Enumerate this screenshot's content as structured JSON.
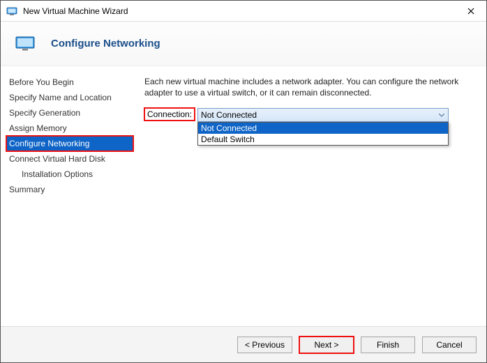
{
  "window": {
    "title": "New Virtual Machine Wizard"
  },
  "header": {
    "page_title": "Configure Networking"
  },
  "sidebar": {
    "items": [
      {
        "label": "Before You Begin"
      },
      {
        "label": "Specify Name and Location"
      },
      {
        "label": "Specify Generation"
      },
      {
        "label": "Assign Memory"
      },
      {
        "label": "Configure Networking"
      },
      {
        "label": "Connect Virtual Hard Disk"
      },
      {
        "label": "Installation Options"
      },
      {
        "label": "Summary"
      }
    ]
  },
  "main": {
    "description": "Each new virtual machine includes a network adapter. You can configure the network adapter to use a virtual switch, or it can remain disconnected.",
    "connection_label": "Connection:",
    "connection_selected": "Not Connected",
    "connection_options": [
      "Not Connected",
      "Default Switch"
    ]
  },
  "footer": {
    "previous": "< Previous",
    "next": "Next >",
    "finish": "Finish",
    "cancel": "Cancel"
  }
}
